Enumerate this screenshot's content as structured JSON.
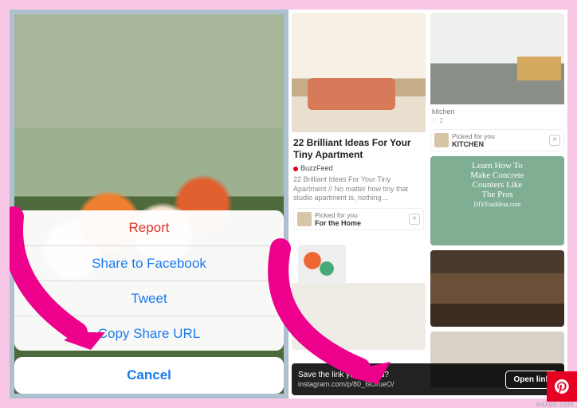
{
  "left": {
    "actionSheet": {
      "items": [
        {
          "label": "Report",
          "destructive": true
        },
        {
          "label": "Share to Facebook",
          "destructive": false
        },
        {
          "label": "Tweet",
          "destructive": false
        },
        {
          "label": "Copy Share URL",
          "destructive": false
        }
      ],
      "cancel": "Cancel"
    }
  },
  "right": {
    "col1": {
      "card1": {
        "title": "22 Brilliant Ideas For Your Tiny Apartment",
        "source": "BuzzFeed",
        "desc": "22 Brilliant Ideas For Your Tiny Apartment // No matter how tiny that studio apartment is, nothing…",
        "picked_label": "Picked for you",
        "picked_board": "For the Home"
      }
    },
    "col2": {
      "kitchen_caption": "kitchen",
      "kitchen_likes": "♡ 2",
      "kitchen_picked_label": "Picked for you",
      "kitchen_picked_board": "KITCHEN",
      "concrete_text1": "Learn How To",
      "concrete_text2": "Make Concrete",
      "concrete_text3": "Counters Like",
      "concrete_text4": "The Pros",
      "concrete_credit": "DIYFunIdeas.com"
    },
    "toast": {
      "title": "Save the link you copied?",
      "url": "instagram.com/p/80_IsOrueO/",
      "action": "Open link"
    }
  },
  "watermark": "wsxdn.com"
}
